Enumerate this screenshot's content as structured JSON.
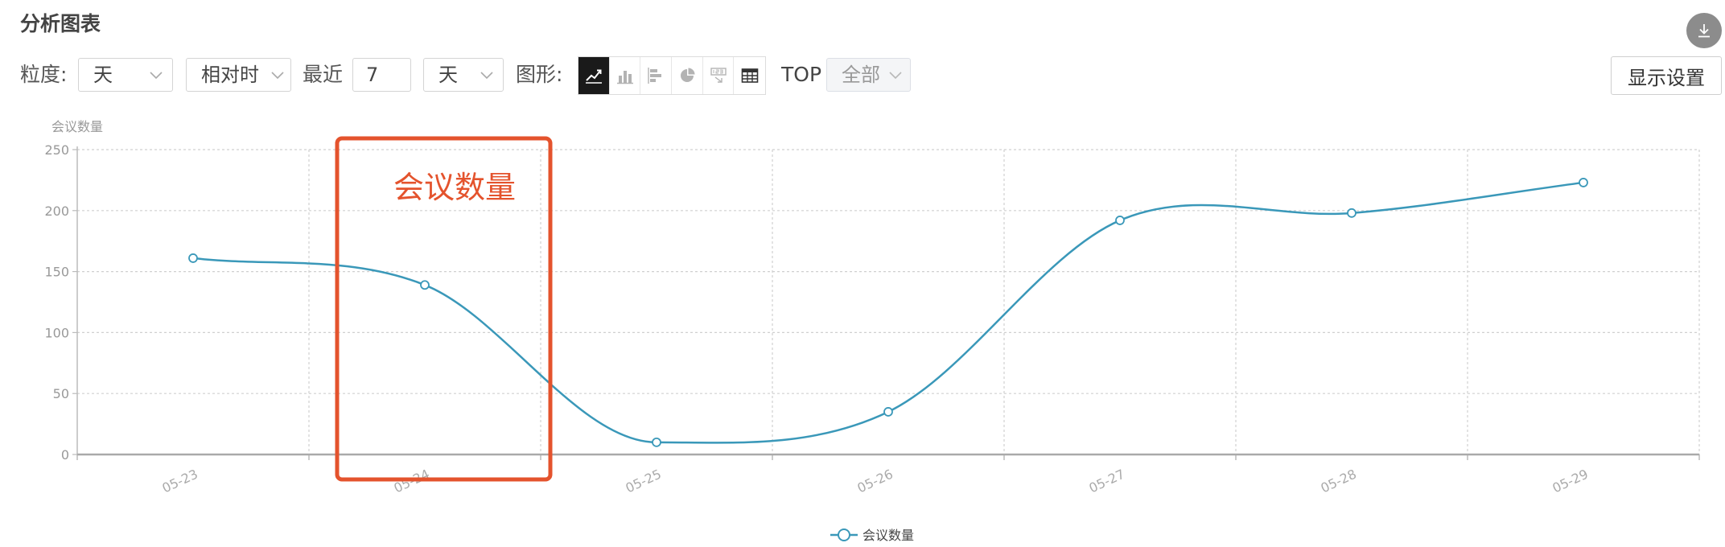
{
  "panel": {
    "title": "分析图表"
  },
  "toolbar": {
    "granularity_label": "粒度:",
    "granularity_value": "天",
    "time_mode_value": "相对时",
    "recent_label": "最近",
    "recent_count": "7",
    "recent_unit_value": "天",
    "chart_type_label": "图形:",
    "chart_types": [
      "line-chart-icon",
      "bar-chart-icon",
      "horizontal-bar-icon",
      "pie-chart-icon",
      "number-card-icon",
      "table-icon"
    ],
    "active_chart_type": "line-chart-icon",
    "top_label": "TOP",
    "top_value": "全部",
    "display_settings_label": "显示设置"
  },
  "colors": {
    "series": "#3a98b9",
    "highlight_box": "#e4532d",
    "active_icon_bg": "#1a1a1a"
  },
  "annotation": {
    "text": "会议数量"
  },
  "chart_data": {
    "type": "line",
    "ylabel": "会议数量",
    "ylim": [
      0,
      250
    ],
    "yticks": [
      0,
      50,
      100,
      150,
      200,
      250
    ],
    "categories": [
      "05-23",
      "05-24",
      "05-25",
      "05-26",
      "05-27",
      "05-28",
      "05-29"
    ],
    "series": [
      {
        "name": "会议数量",
        "values": [
          161,
          139,
          10,
          35,
          192,
          198,
          223
        ]
      }
    ],
    "grid": true,
    "legend": "bottom-center",
    "smooth": true
  }
}
